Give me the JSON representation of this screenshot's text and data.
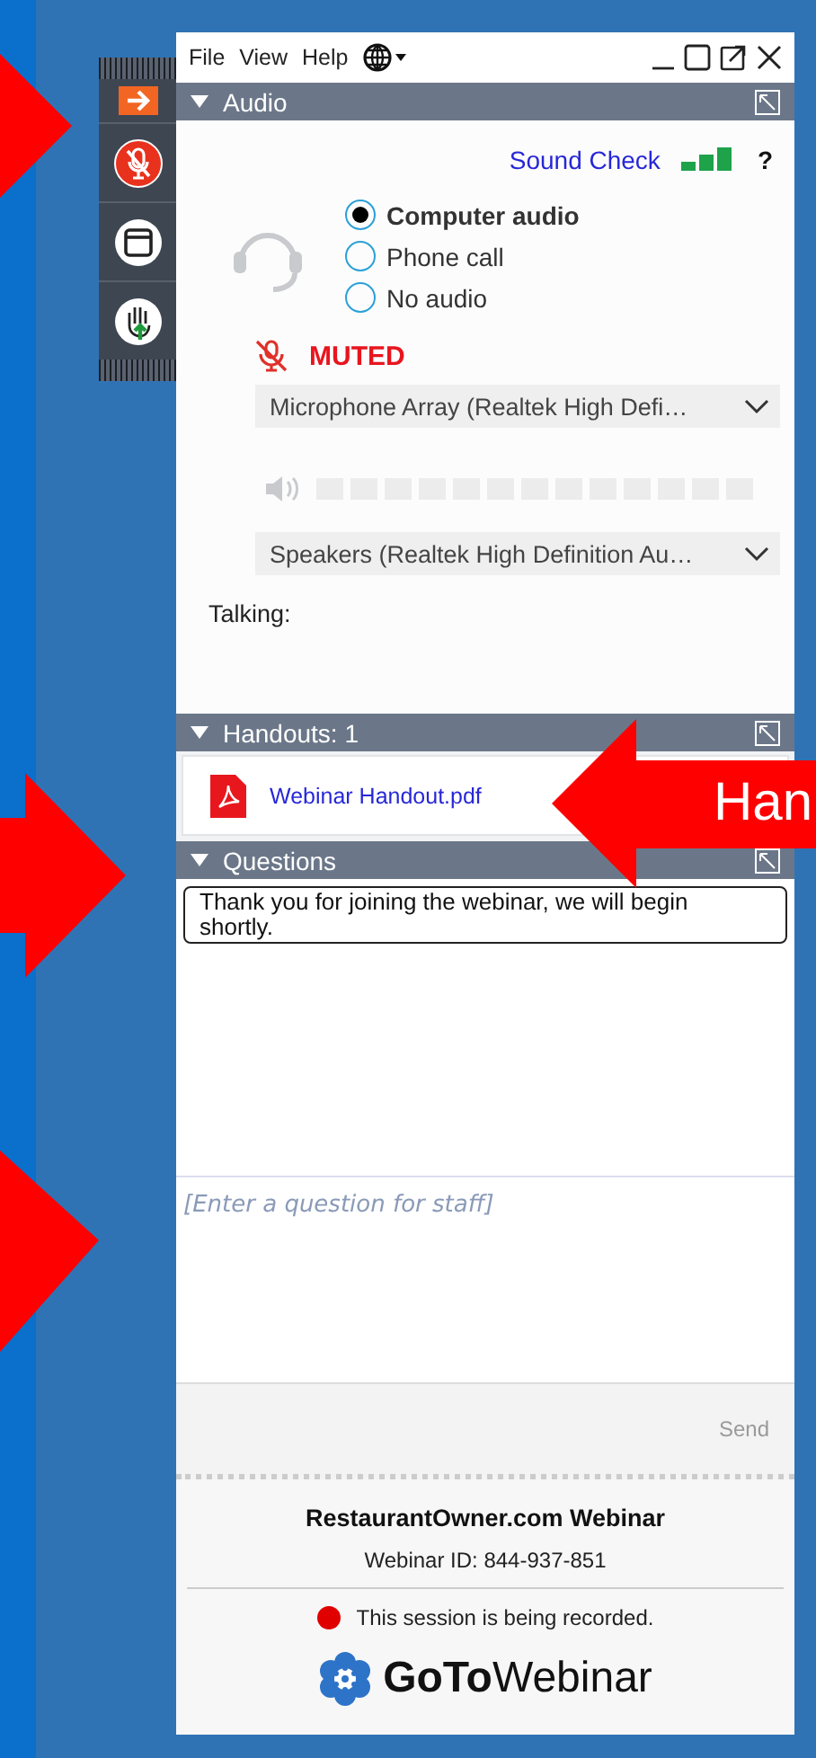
{
  "control_panel": {
    "mic_muted": true
  },
  "menu": [
    "File",
    "View",
    "Help"
  ],
  "audio": {
    "title": "Audio",
    "sound_check": "Sound Check",
    "help": "?",
    "options": [
      {
        "label": "Computer audio",
        "selected": true
      },
      {
        "label": "Phone call",
        "selected": false
      },
      {
        "label": "No audio",
        "selected": false
      }
    ],
    "mute_status": "MUTED",
    "microphone": "Microphone Array (Realtek High Defi…",
    "speakers": "Speakers (Realtek High Definition Au…",
    "talking_label": "Talking:"
  },
  "handouts": {
    "title": "Handouts: 1",
    "files": [
      "Webinar Handout.pdf"
    ]
  },
  "questions": {
    "title": "Questions",
    "messages": [
      "Thank you for joining the webinar, we will begin shortly."
    ],
    "placeholder": "[Enter a question for staff]",
    "send": "Send",
    "send_disabled": true
  },
  "footer": {
    "webinar_title": "RestaurantOwner.com Webinar",
    "webinar_id": "Webinar ID: 844-937-851",
    "recording_notice": "This session is being recorded.",
    "logo_bold": "GoTo",
    "logo_light": "Webinar"
  },
  "annotations": {
    "callout_text": "Han"
  }
}
